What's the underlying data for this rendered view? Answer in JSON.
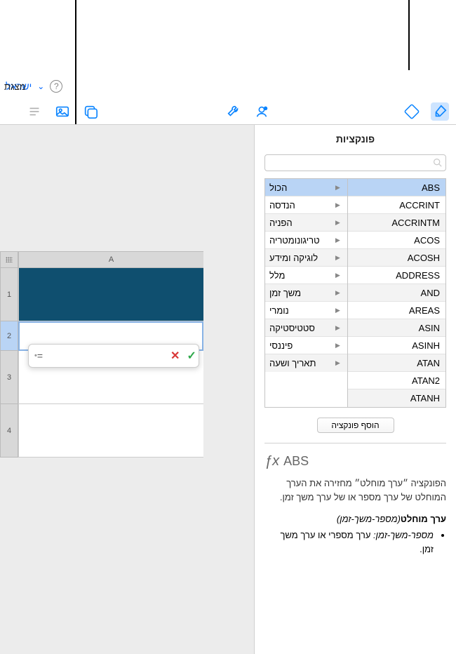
{
  "topbar": {
    "left_title": "מצגת",
    "doc_link": "ישראל",
    "help": "?"
  },
  "panel": {
    "title": "פונקציות",
    "search_placeholder": "",
    "categories": [
      "הכול",
      "הנדסה",
      "הפניה",
      "טריגונומטריה",
      "לוגיקה ומידע",
      "מלל",
      "משך זמן",
      "נומרי",
      "סטטיסטיקה",
      "פיננסי",
      "תאריך ושעה"
    ],
    "functions": [
      "ABS",
      "ACCRINT",
      "ACCRINTM",
      "ACOS",
      "ACOSH",
      "ADDRESS",
      "AND",
      "AREAS",
      "ASIN",
      "ASINH",
      "ATAN",
      "ATAN2",
      "ATANH"
    ],
    "add_button": "הוסף פונקציה",
    "selected_category_idx": 0,
    "selected_function_idx": 0,
    "desc": {
      "name": "ABS",
      "fx": "ƒx",
      "body": "הפונקציה ״ערך מוחלט״ מחזירה את הערך המוחלט של ערך מספר או של ערך משך זמן.",
      "syntax_name": "ערך מוחלט",
      "syntax_args": "(מספר-משך-זמן)",
      "bullet_arg": "מספר-משך-זמן:",
      "bullet_text": " ערך מספרי או ערך משך זמן."
    }
  },
  "sheet": {
    "col": "A",
    "rows": [
      "1",
      "2",
      "3",
      "4"
    ]
  },
  "formula": {
    "eq": "=",
    "value": ""
  }
}
